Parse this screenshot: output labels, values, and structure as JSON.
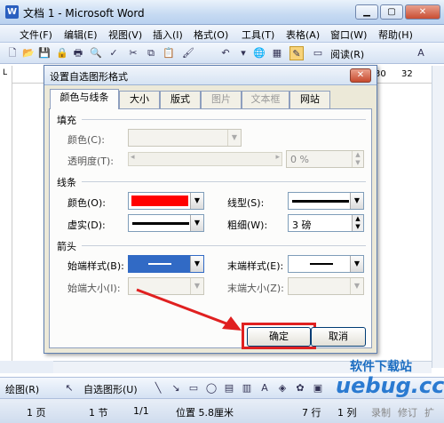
{
  "window": {
    "title": "文档 1 - Microsoft Word",
    "app_icon": "W"
  },
  "menu": [
    "文件(F)",
    "编辑(E)",
    "视图(V)",
    "插入(I)",
    "格式(O)",
    "工具(T)",
    "表格(A)",
    "窗口(W)",
    "帮助(H)"
  ],
  "toolbar": {
    "read_label": "阅读(R)"
  },
  "ruler": {
    "marks": [
      "30",
      "32"
    ]
  },
  "dialog": {
    "title": "设置自选图形格式",
    "tabs": [
      "颜色与线条",
      "大小",
      "版式",
      "图片",
      "文本框",
      "网站"
    ],
    "fill": {
      "section": "填充",
      "color_label": "颜色(C):",
      "transparency_label": "透明度(T):",
      "transparency_value": "0 %"
    },
    "line": {
      "section": "线条",
      "color_label": "颜色(O):",
      "color_value": "#ff0000",
      "dash_label": "虚实(D):",
      "style_label": "线型(S):",
      "weight_label": "粗细(W):",
      "weight_value": "3 磅"
    },
    "arrows": {
      "section": "箭头",
      "begin_style_label": "始端样式(B):",
      "begin_size_label": "始端大小(I):",
      "end_style_label": "末端样式(E):",
      "end_size_label": "末端大小(Z):"
    },
    "ok_label": "确定",
    "cancel_label": "取消"
  },
  "drawbar": {
    "draw_label": "绘图(R)",
    "autoshapes_label": "自选图形(U)"
  },
  "status": {
    "page": "1 页",
    "section": "1 节",
    "pages": "1/1",
    "position": "位置 5.8厘米",
    "line": "7 行",
    "col": "1 列",
    "rec": "录制",
    "trk": "修订",
    "ext": "扩"
  },
  "watermark": {
    "line1": "软件下载站",
    "line2": "uebug.cc"
  },
  "colors": {
    "accent_red": "#e02020",
    "title_blue": "#c6daf2"
  }
}
